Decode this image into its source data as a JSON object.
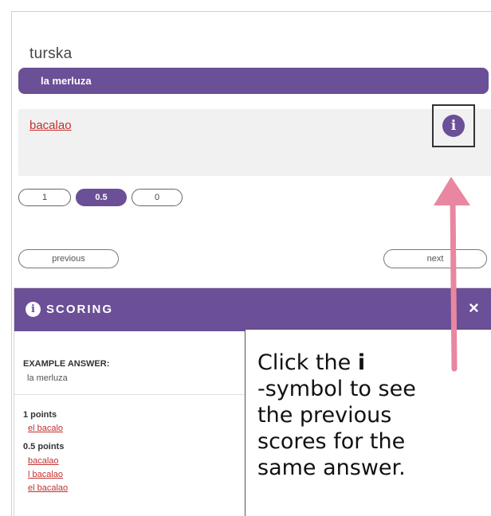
{
  "card": {
    "word": "turska",
    "correct_answer": "la merluza",
    "user_answer": "bacalao"
  },
  "info_button": {
    "glyph": "i",
    "icon": "info-icon"
  },
  "score_options": [
    {
      "label": "1",
      "selected": false
    },
    {
      "label": "0.5",
      "selected": true
    },
    {
      "label": "0",
      "selected": false
    }
  ],
  "nav": {
    "previous_label": "previous",
    "next_label": "next"
  },
  "scoring_panel": {
    "title": "SCORING",
    "close_glyph": "×",
    "example_label": "EXAMPLE ANSWER:",
    "example_value": "la merluza",
    "groups": [
      {
        "points_label": "1 points",
        "answers": [
          "el bacalo"
        ]
      },
      {
        "points_label": "0.5 points",
        "answers": [
          "bacalao",
          "l bacalao",
          "el bacalao"
        ]
      }
    ]
  },
  "callout": {
    "line1_prefix": "Click the ",
    "line1_bold": "i",
    "rest": "-symbol to see\nthe previous\nscores for the\nsame answer."
  },
  "colors": {
    "accent": "#6b4f97",
    "answer_red": "#c22f2f",
    "arrow_pink": "#e8879f"
  }
}
